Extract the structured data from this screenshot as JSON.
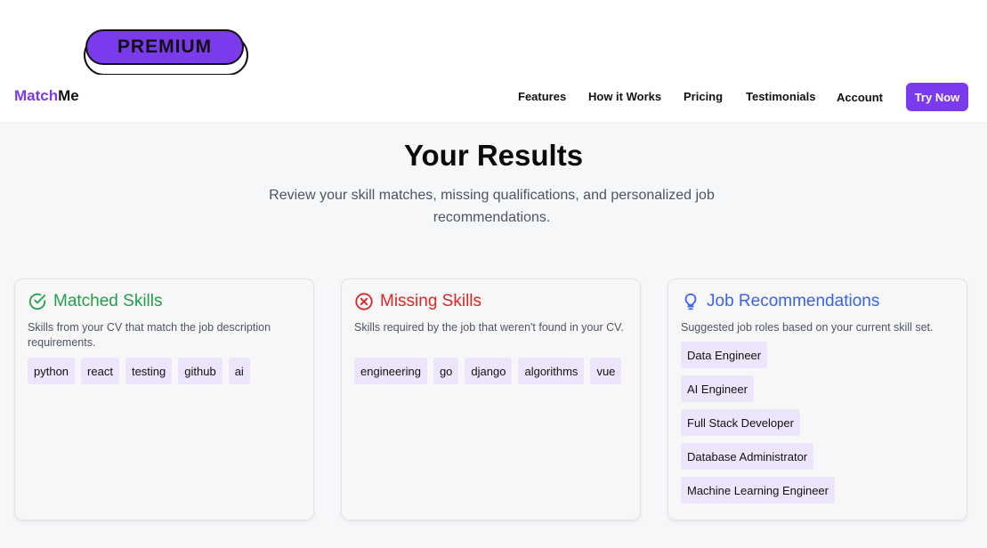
{
  "badge": {
    "label": "PREMIUM"
  },
  "header": {
    "logo_part1": "Match",
    "logo_part2": "Me",
    "nav": [
      "Features",
      "How it Works",
      "Pricing",
      "Testimonials",
      "Account"
    ],
    "cta": "Try Now"
  },
  "main": {
    "title": "Your Results",
    "subtitle": "Review your skill matches, missing qualifications, and personalized job recommendations."
  },
  "cards": {
    "matched": {
      "title": "Matched Skills",
      "description": "Skills from your CV that match the job description requirements.",
      "skills": [
        "python",
        "react",
        "testing",
        "github",
        "ai"
      ]
    },
    "missing": {
      "title": "Missing Skills",
      "description": "Skills required by the job that weren't found in your CV.",
      "skills": [
        "engineering",
        "go",
        "django",
        "algorithms",
        "vue"
      ]
    },
    "recommendations": {
      "title": "Job Recommendations",
      "description": "Suggested job roles based on your current skill set.",
      "roles": [
        "Data Engineer",
        "AI Engineer",
        "Full Stack Developer",
        "Database Administrator",
        "Machine Learning Engineer"
      ]
    }
  },
  "colors": {
    "brand": "#7c3aed",
    "matched": "#22a04b",
    "missing": "#dc2626",
    "recommend": "#3b63e6",
    "tag_bg": "#ede5fb"
  },
  "icons": {
    "matched": "check-circle-icon",
    "missing": "x-circle-icon",
    "recommend": "lightbulb-icon"
  }
}
